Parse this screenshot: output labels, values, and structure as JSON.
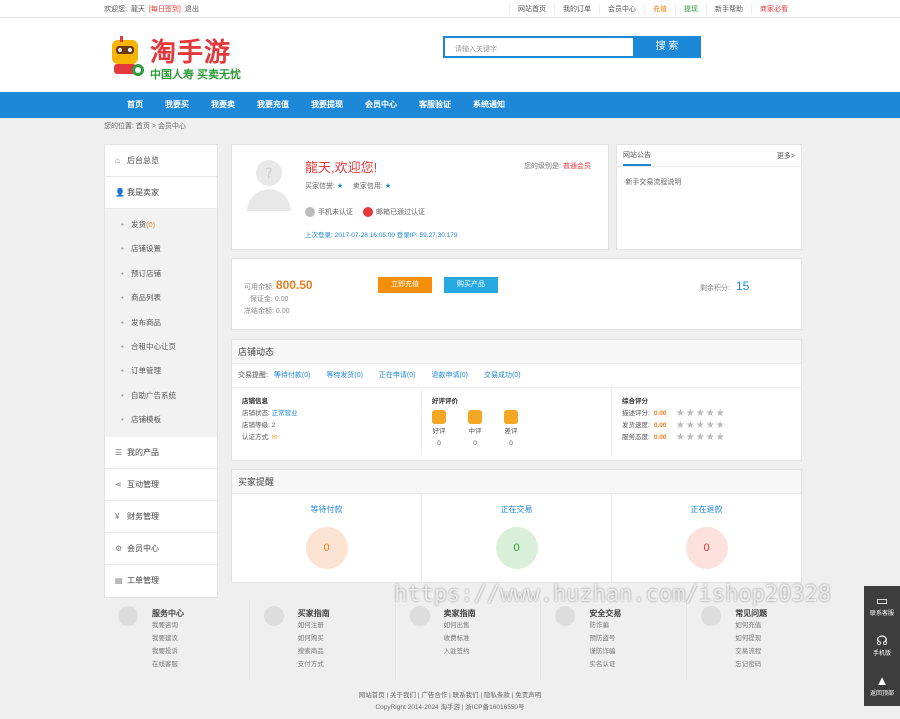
{
  "topbar": {
    "welcome": "欢迎您:",
    "username": "龍天",
    "checkin": "[每日签到]",
    "logout": "退出",
    "links": [
      "网站首页",
      "我的订单",
      "会员中心",
      "充值",
      "提现",
      "新手帮助",
      "商家必看"
    ]
  },
  "logo": {
    "name": "淘手游",
    "slogan": "中国人寿 买卖无忧"
  },
  "search": {
    "placeholder": "请输入关键字",
    "button": "搜 索"
  },
  "nav": [
    "首页",
    "我要买",
    "我要卖",
    "我要充值",
    "我要提现",
    "会员中心",
    "客服验证",
    "系统通知"
  ],
  "breadcrumb": "您的位置: 首页 > 会员中心",
  "sidebar": {
    "home": "后台总览",
    "seller": "我是卖家",
    "sub": [
      "发货",
      "店铺设置",
      "预订店铺",
      "商品列表",
      "发布商品",
      "合租中心让页",
      "订单管理",
      "自助广告系统",
      "店铺模板"
    ],
    "sub_count": "(0)",
    "rest": [
      "我的产品",
      "互动管理",
      "财务管理",
      "会员中心",
      "工单管理"
    ]
  },
  "profile": {
    "welcome": "龍天,欢迎您!",
    "grade_label": "您的级别是:",
    "grade": "普通会员",
    "buyer_credit": "买家信誉:",
    "seller_credit": "卖家信用:",
    "phone_cert": "手机未认证",
    "email_cert": "邮箱已通过认证",
    "last_login": "上次登录: 2017-07-28 16:05:00     登录IP: 59.27.30.179"
  },
  "notice": {
    "tab": "网站公告",
    "more": "更多>",
    "item": "·新手交易流程说明"
  },
  "balance": {
    "available_label": "可用余额:",
    "available": "800.50",
    "deposit_label": "保证金:",
    "deposit": "0.00",
    "frozen_label": "冻结余额:",
    "frozen": "0.00",
    "recharge_btn": "立即充值",
    "buy_btn": "购买产品",
    "points_label": "剩余积分:",
    "points": "15"
  },
  "shop": {
    "title": "店铺动态",
    "trade_label": "交易提醒:",
    "trade_items": [
      "等待付款(0)",
      "等待发货(0)",
      "正在申请(0)",
      "退款申请(0)",
      "交易成功(0)"
    ],
    "info_title": "店铺信息",
    "info_status_label": "店铺状态:",
    "info_status": "正常营业",
    "info_level_label": "店铺等级:",
    "info_level": "2",
    "info_cert_label": "认证方式:",
    "eval_title": "好评评价",
    "eval_items": [
      {
        "label": "好评",
        "count": "0"
      },
      {
        "label": "中评",
        "count": "0"
      },
      {
        "label": "差评",
        "count": "0"
      }
    ],
    "score_title": "综合评分",
    "scores": [
      {
        "label": "描述评分:",
        "value": "0.00"
      },
      {
        "label": "发货速度:",
        "value": "0.00"
      },
      {
        "label": "服务态度:",
        "value": "0.00"
      }
    ]
  },
  "remind": {
    "title": "买家提醒",
    "items": [
      {
        "label": "等待付款",
        "count": "0"
      },
      {
        "label": "正在交易",
        "count": "0"
      },
      {
        "label": "正在退款",
        "count": "0"
      }
    ]
  },
  "footer": {
    "cols": [
      {
        "title": "服务中心",
        "items": [
          "我要咨询",
          "我要建议",
          "我要投诉",
          "在线客服"
        ]
      },
      {
        "title": "买家指南",
        "items": [
          "如何注册",
          "如何购买",
          "搜索商品",
          "支付方式"
        ]
      },
      {
        "title": "卖家指南",
        "items": [
          "如何出售",
          "收费标准",
          "入驻签约"
        ]
      },
      {
        "title": "安全交易",
        "items": [
          "防诈骗",
          "预防盗号",
          "谨防诈骗",
          "实名认证"
        ]
      },
      {
        "title": "常见问题",
        "items": [
          "如何充值",
          "如何提现",
          "交易流程",
          "忘记密码"
        ]
      }
    ],
    "links": "网站首页 | 关于我们 | 广告合作 | 联系我们 | 隐私条款 | 免责声明",
    "copyright": "CopyRight 2014-2024 淘手游 | 浙ICP备16016550号"
  },
  "float": {
    "service": "联系客服",
    "mobile": "手机版",
    "top": "返回顶部"
  },
  "watermark": "https://www.huzhan.com/ishop20328"
}
